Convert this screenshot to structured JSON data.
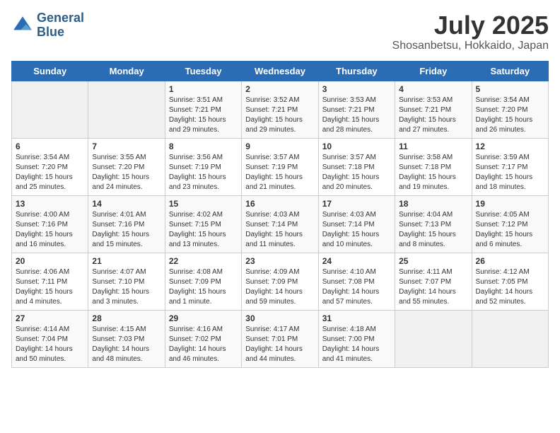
{
  "header": {
    "logo_line1": "General",
    "logo_line2": "Blue",
    "title": "July 2025",
    "subtitle": "Shosanbetsu, Hokkaido, Japan"
  },
  "weekdays": [
    "Sunday",
    "Monday",
    "Tuesday",
    "Wednesday",
    "Thursday",
    "Friday",
    "Saturday"
  ],
  "weeks": [
    [
      {
        "day": "",
        "empty": true
      },
      {
        "day": "",
        "empty": true
      },
      {
        "day": "1",
        "sunrise": "Sunrise: 3:51 AM",
        "sunset": "Sunset: 7:21 PM",
        "daylight": "Daylight: 15 hours and 29 minutes."
      },
      {
        "day": "2",
        "sunrise": "Sunrise: 3:52 AM",
        "sunset": "Sunset: 7:21 PM",
        "daylight": "Daylight: 15 hours and 29 minutes."
      },
      {
        "day": "3",
        "sunrise": "Sunrise: 3:53 AM",
        "sunset": "Sunset: 7:21 PM",
        "daylight": "Daylight: 15 hours and 28 minutes."
      },
      {
        "day": "4",
        "sunrise": "Sunrise: 3:53 AM",
        "sunset": "Sunset: 7:21 PM",
        "daylight": "Daylight: 15 hours and 27 minutes."
      },
      {
        "day": "5",
        "sunrise": "Sunrise: 3:54 AM",
        "sunset": "Sunset: 7:20 PM",
        "daylight": "Daylight: 15 hours and 26 minutes."
      }
    ],
    [
      {
        "day": "6",
        "sunrise": "Sunrise: 3:54 AM",
        "sunset": "Sunset: 7:20 PM",
        "daylight": "Daylight: 15 hours and 25 minutes."
      },
      {
        "day": "7",
        "sunrise": "Sunrise: 3:55 AM",
        "sunset": "Sunset: 7:20 PM",
        "daylight": "Daylight: 15 hours and 24 minutes."
      },
      {
        "day": "8",
        "sunrise": "Sunrise: 3:56 AM",
        "sunset": "Sunset: 7:19 PM",
        "daylight": "Daylight: 15 hours and 23 minutes."
      },
      {
        "day": "9",
        "sunrise": "Sunrise: 3:57 AM",
        "sunset": "Sunset: 7:19 PM",
        "daylight": "Daylight: 15 hours and 21 minutes."
      },
      {
        "day": "10",
        "sunrise": "Sunrise: 3:57 AM",
        "sunset": "Sunset: 7:18 PM",
        "daylight": "Daylight: 15 hours and 20 minutes."
      },
      {
        "day": "11",
        "sunrise": "Sunrise: 3:58 AM",
        "sunset": "Sunset: 7:18 PM",
        "daylight": "Daylight: 15 hours and 19 minutes."
      },
      {
        "day": "12",
        "sunrise": "Sunrise: 3:59 AM",
        "sunset": "Sunset: 7:17 PM",
        "daylight": "Daylight: 15 hours and 18 minutes."
      }
    ],
    [
      {
        "day": "13",
        "sunrise": "Sunrise: 4:00 AM",
        "sunset": "Sunset: 7:16 PM",
        "daylight": "Daylight: 15 hours and 16 minutes."
      },
      {
        "day": "14",
        "sunrise": "Sunrise: 4:01 AM",
        "sunset": "Sunset: 7:16 PM",
        "daylight": "Daylight: 15 hours and 15 minutes."
      },
      {
        "day": "15",
        "sunrise": "Sunrise: 4:02 AM",
        "sunset": "Sunset: 7:15 PM",
        "daylight": "Daylight: 15 hours and 13 minutes."
      },
      {
        "day": "16",
        "sunrise": "Sunrise: 4:03 AM",
        "sunset": "Sunset: 7:14 PM",
        "daylight": "Daylight: 15 hours and 11 minutes."
      },
      {
        "day": "17",
        "sunrise": "Sunrise: 4:03 AM",
        "sunset": "Sunset: 7:14 PM",
        "daylight": "Daylight: 15 hours and 10 minutes."
      },
      {
        "day": "18",
        "sunrise": "Sunrise: 4:04 AM",
        "sunset": "Sunset: 7:13 PM",
        "daylight": "Daylight: 15 hours and 8 minutes."
      },
      {
        "day": "19",
        "sunrise": "Sunrise: 4:05 AM",
        "sunset": "Sunset: 7:12 PM",
        "daylight": "Daylight: 15 hours and 6 minutes."
      }
    ],
    [
      {
        "day": "20",
        "sunrise": "Sunrise: 4:06 AM",
        "sunset": "Sunset: 7:11 PM",
        "daylight": "Daylight: 15 hours and 4 minutes."
      },
      {
        "day": "21",
        "sunrise": "Sunrise: 4:07 AM",
        "sunset": "Sunset: 7:10 PM",
        "daylight": "Daylight: 15 hours and 3 minutes."
      },
      {
        "day": "22",
        "sunrise": "Sunrise: 4:08 AM",
        "sunset": "Sunset: 7:09 PM",
        "daylight": "Daylight: 15 hours and 1 minute."
      },
      {
        "day": "23",
        "sunrise": "Sunrise: 4:09 AM",
        "sunset": "Sunset: 7:09 PM",
        "daylight": "Daylight: 14 hours and 59 minutes."
      },
      {
        "day": "24",
        "sunrise": "Sunrise: 4:10 AM",
        "sunset": "Sunset: 7:08 PM",
        "daylight": "Daylight: 14 hours and 57 minutes."
      },
      {
        "day": "25",
        "sunrise": "Sunrise: 4:11 AM",
        "sunset": "Sunset: 7:07 PM",
        "daylight": "Daylight: 14 hours and 55 minutes."
      },
      {
        "day": "26",
        "sunrise": "Sunrise: 4:12 AM",
        "sunset": "Sunset: 7:05 PM",
        "daylight": "Daylight: 14 hours and 52 minutes."
      }
    ],
    [
      {
        "day": "27",
        "sunrise": "Sunrise: 4:14 AM",
        "sunset": "Sunset: 7:04 PM",
        "daylight": "Daylight: 14 hours and 50 minutes."
      },
      {
        "day": "28",
        "sunrise": "Sunrise: 4:15 AM",
        "sunset": "Sunset: 7:03 PM",
        "daylight": "Daylight: 14 hours and 48 minutes."
      },
      {
        "day": "29",
        "sunrise": "Sunrise: 4:16 AM",
        "sunset": "Sunset: 7:02 PM",
        "daylight": "Daylight: 14 hours and 46 minutes."
      },
      {
        "day": "30",
        "sunrise": "Sunrise: 4:17 AM",
        "sunset": "Sunset: 7:01 PM",
        "daylight": "Daylight: 14 hours and 44 minutes."
      },
      {
        "day": "31",
        "sunrise": "Sunrise: 4:18 AM",
        "sunset": "Sunset: 7:00 PM",
        "daylight": "Daylight: 14 hours and 41 minutes."
      },
      {
        "day": "",
        "empty": true
      },
      {
        "day": "",
        "empty": true
      }
    ]
  ]
}
